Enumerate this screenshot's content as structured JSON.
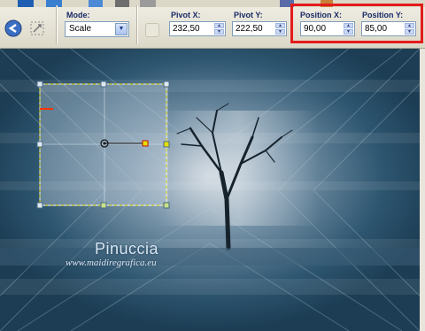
{
  "toolbar": {
    "mode": {
      "label": "Mode:",
      "value": "Scale"
    },
    "pivot_x": {
      "label": "Pivot X:",
      "value": "232,50"
    },
    "pivot_y": {
      "label": "Pivot Y:",
      "value": "222,50"
    },
    "position_x": {
      "label": "Position X:",
      "value": "90,00"
    },
    "position_y": {
      "label": "Position Y:",
      "value": "85,00"
    }
  },
  "canvas": {
    "watermark_name": "Pinuccia",
    "watermark_url": "www.maidiregrafica.eu"
  },
  "icons": {
    "apply": "apply-icon",
    "reset": "reset-icon"
  },
  "colors": {
    "highlight": "#e41c1c",
    "canvas_base": "#254a63"
  }
}
